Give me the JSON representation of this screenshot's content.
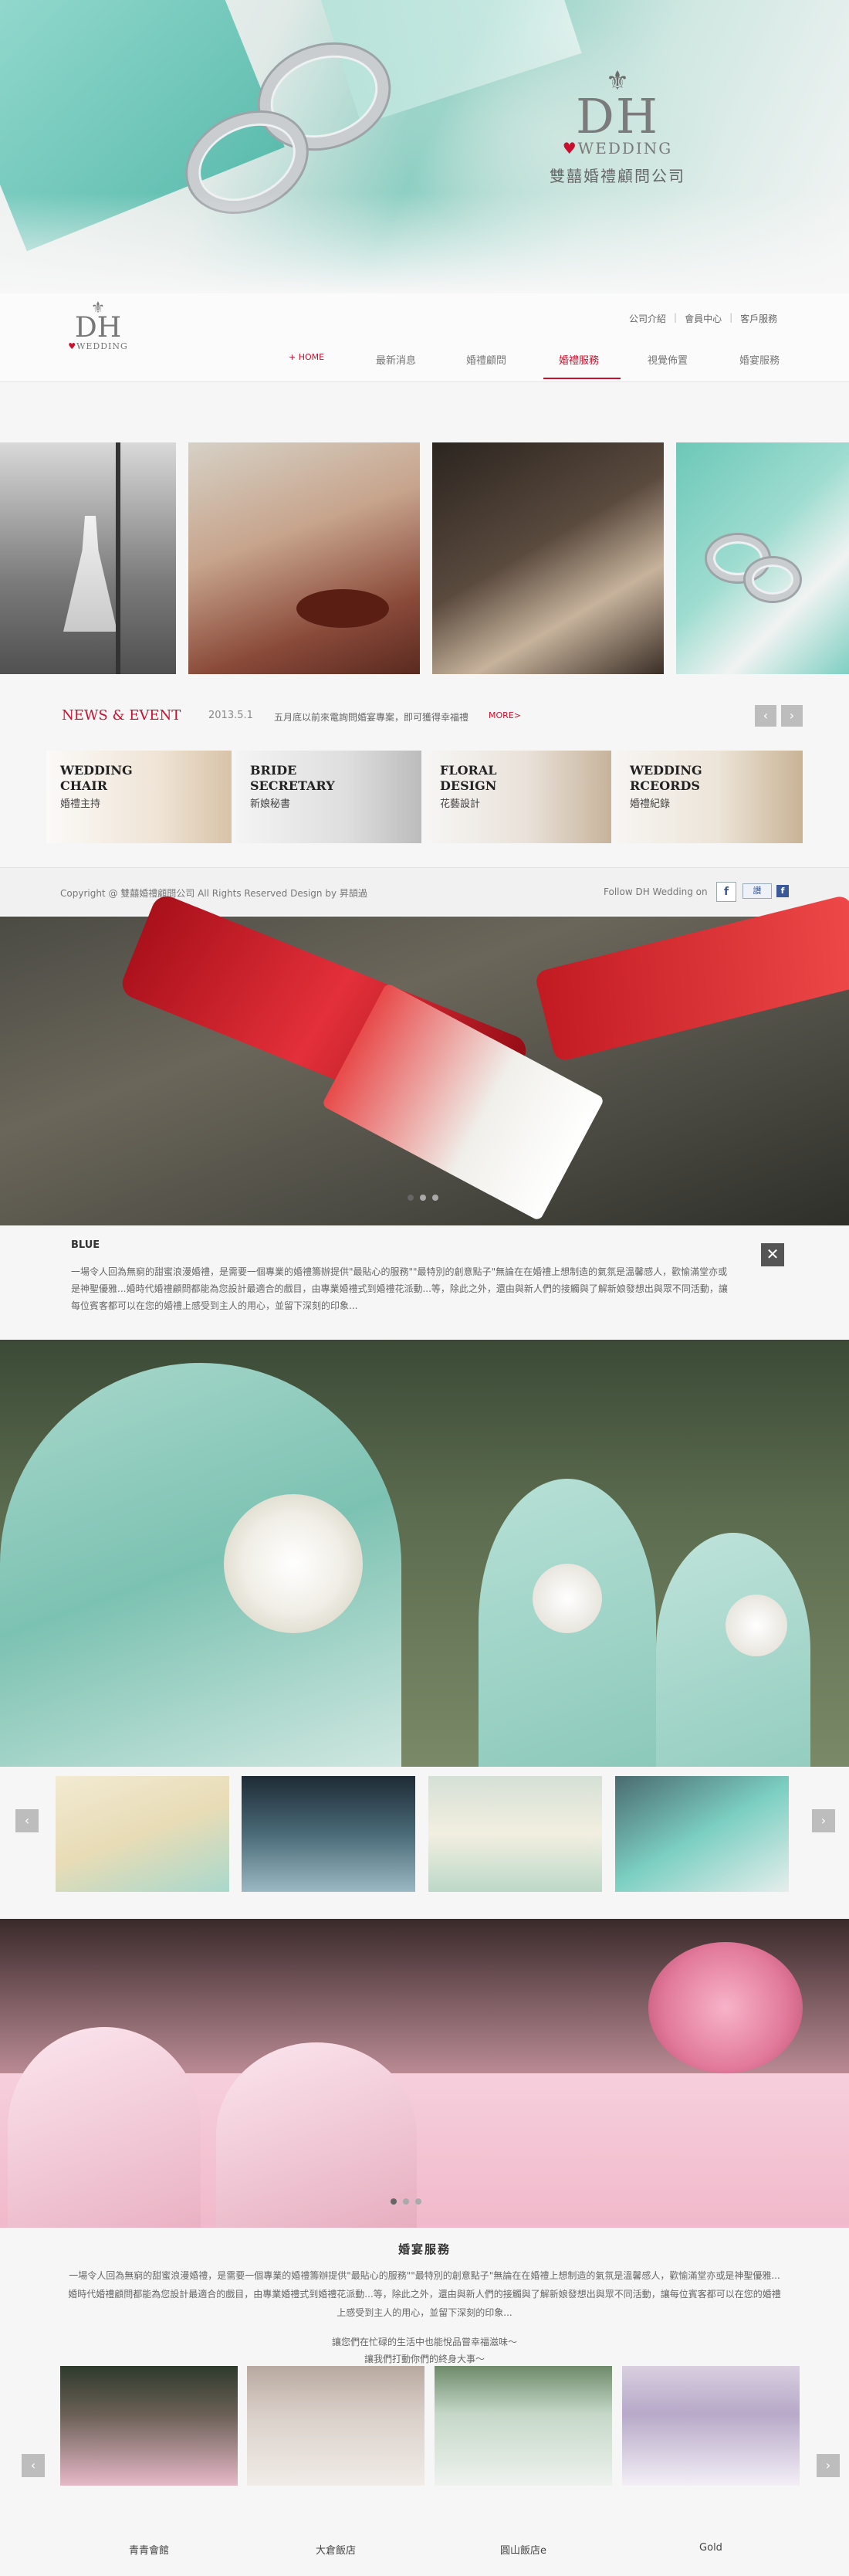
{
  "hero": {
    "logo_text": "DH",
    "logo_sub": "WEDDING",
    "company_name": "雙囍婚禮顧問公司"
  },
  "header": {
    "logo_text": "DH",
    "logo_sub": "WEDDING",
    "top_links": [
      "公司介紹",
      "會員中心",
      "客戶服務"
    ],
    "nav": [
      {
        "label": "+ HOME"
      },
      {
        "label": "最新消息"
      },
      {
        "label": "婚禮顧問"
      },
      {
        "label": "婚禮服務",
        "active": true
      },
      {
        "label": "視覺佈置"
      },
      {
        "label": "婚宴服務"
      }
    ]
  },
  "news": {
    "title": "NEWS & EVENT",
    "date": "2013.5.1",
    "text": "五月底以前來電詢問婚宴專案，即可獲得幸福禮",
    "more": "MORE>",
    "prev": "‹",
    "next": "›"
  },
  "services": [
    {
      "en": "WEDDING\nCHAIR",
      "zh": "婚禮主持"
    },
    {
      "en": "BRIDE\nSECRETARY",
      "zh": "新娘秘書"
    },
    {
      "en": "FLORAL\nDESIGN",
      "zh": "花藝設計"
    },
    {
      "en": "WEDDING\nRCEORDS",
      "zh": "婚禮紀錄"
    }
  ],
  "footer": {
    "copyright": "Copyright @ 雙囍婚禮顧問公司  All Rights Reserved  Design by 昇頡過",
    "follow": "Follow DH Wedding on",
    "fb": "f",
    "like": "讚"
  },
  "caption": {
    "title": "BLUE",
    "text": "一場令人回為無窮的甜蜜浪漫婚禮，是需要一個專業的婚禮籌辦提供\"最貼心的服務\"\"最特別的創意點子\"無論在在婚禮上想制造的氣氛是溫馨感人，歡愉滿堂亦或是神聖優雅...婚時代婚禮顧問都能為您設計最適合的戲目，由專業婚禮式到婚禮花派動...等，除此之外，還由與新人們的接觸與了解新娘發想出與眾不同活動，讓每位賓客都可以在您的婚禮上感受到主人的用心，並留下深刻的印象...",
    "close": "✕"
  },
  "thumb_arrows": {
    "prev": "‹",
    "next": "›"
  },
  "banquet": {
    "title": "婚宴服務",
    "text": "一場令人回為無窮的甜蜜浪漫婚禮，是需要一個專業的婚禮籌辦提供\"最貼心的服務\"\"最特別的創意點子\"無論在在婚禮上想制造的氣氛是溫馨感人，歡愉滿堂亦或是神聖優雅...婚時代婚禮顧問都能為您設計最適合的戲目，由專業婚禮式到婚禮花派動...等，除此之外，還由與新人們的接觸與了解新娘發想出與眾不同活動，讓每位賓客都可以在您的婚禮上感受到主人的用心，並留下深刻的印象...",
    "text2a": "讓您們在忙碌的生活中也能悅品嘗幸福滋味～",
    "text2b": "讓我們打動你們的終身大事～"
  },
  "venues": [
    "青青會館",
    "大倉飯店",
    "圓山飯店e",
    "Gold"
  ],
  "colors": {
    "accent": "#c8102e",
    "tiffany": "#7fd3c6"
  }
}
